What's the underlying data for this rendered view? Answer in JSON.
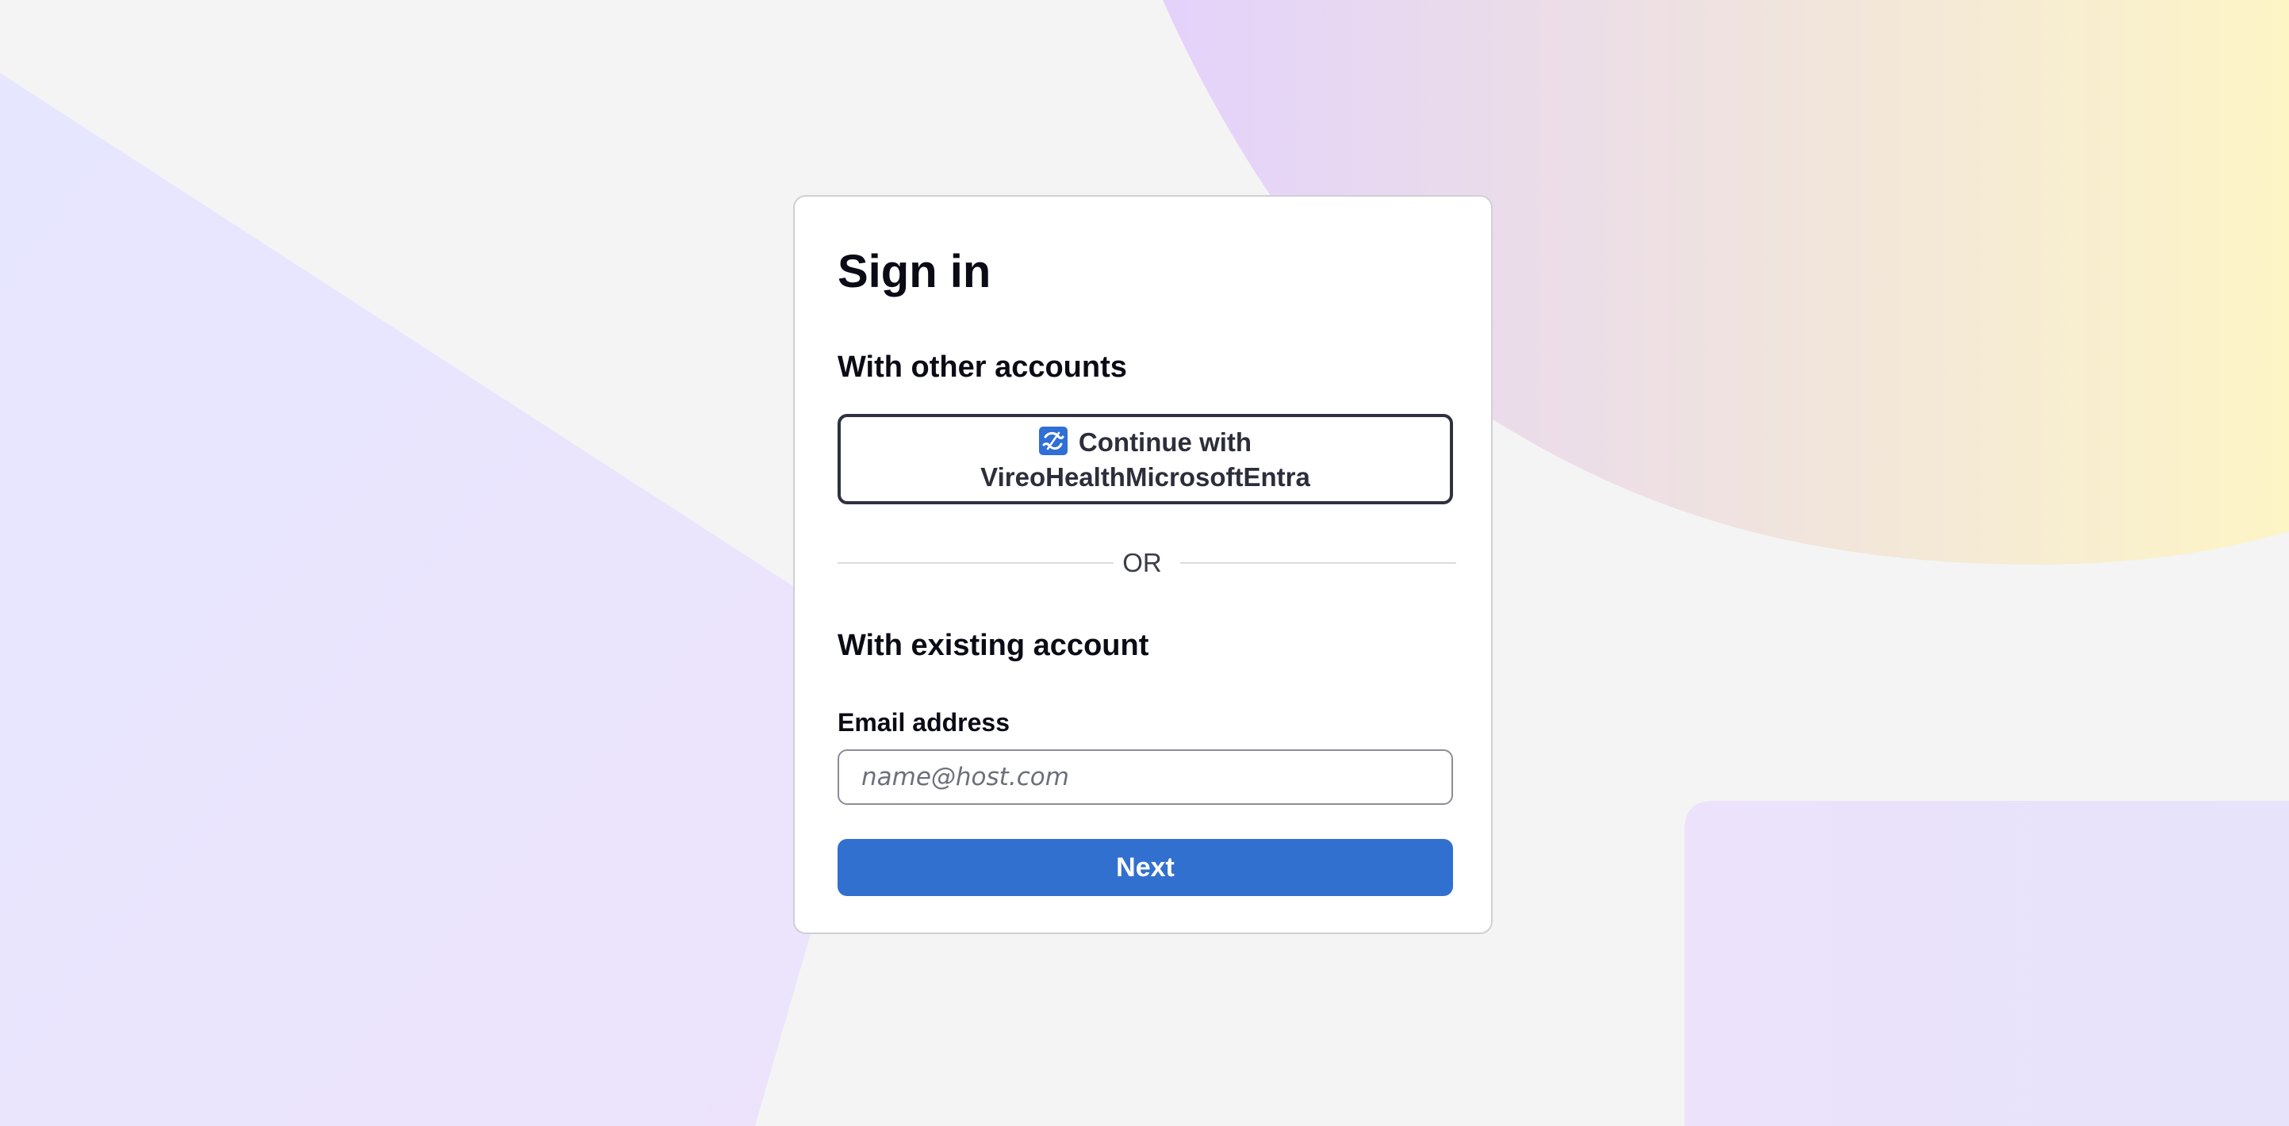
{
  "signin": {
    "title": "Sign in",
    "other_accounts_heading": "With other accounts",
    "sso_button_line1": "Continue with",
    "sso_button_line2": "VireoHealthMicrosoftEntra",
    "divider_text": "OR",
    "existing_account_heading": "With existing account",
    "email_label": "Email address",
    "email_placeholder": "name@host.com",
    "email_value": "",
    "next_label": "Next"
  },
  "icons": {
    "sso_icon": "identity-provider-icon"
  },
  "colors": {
    "primary_button": "#3270cf",
    "sso_icon_background": "#2f6fd6",
    "page_background": "#f4f4f4"
  }
}
